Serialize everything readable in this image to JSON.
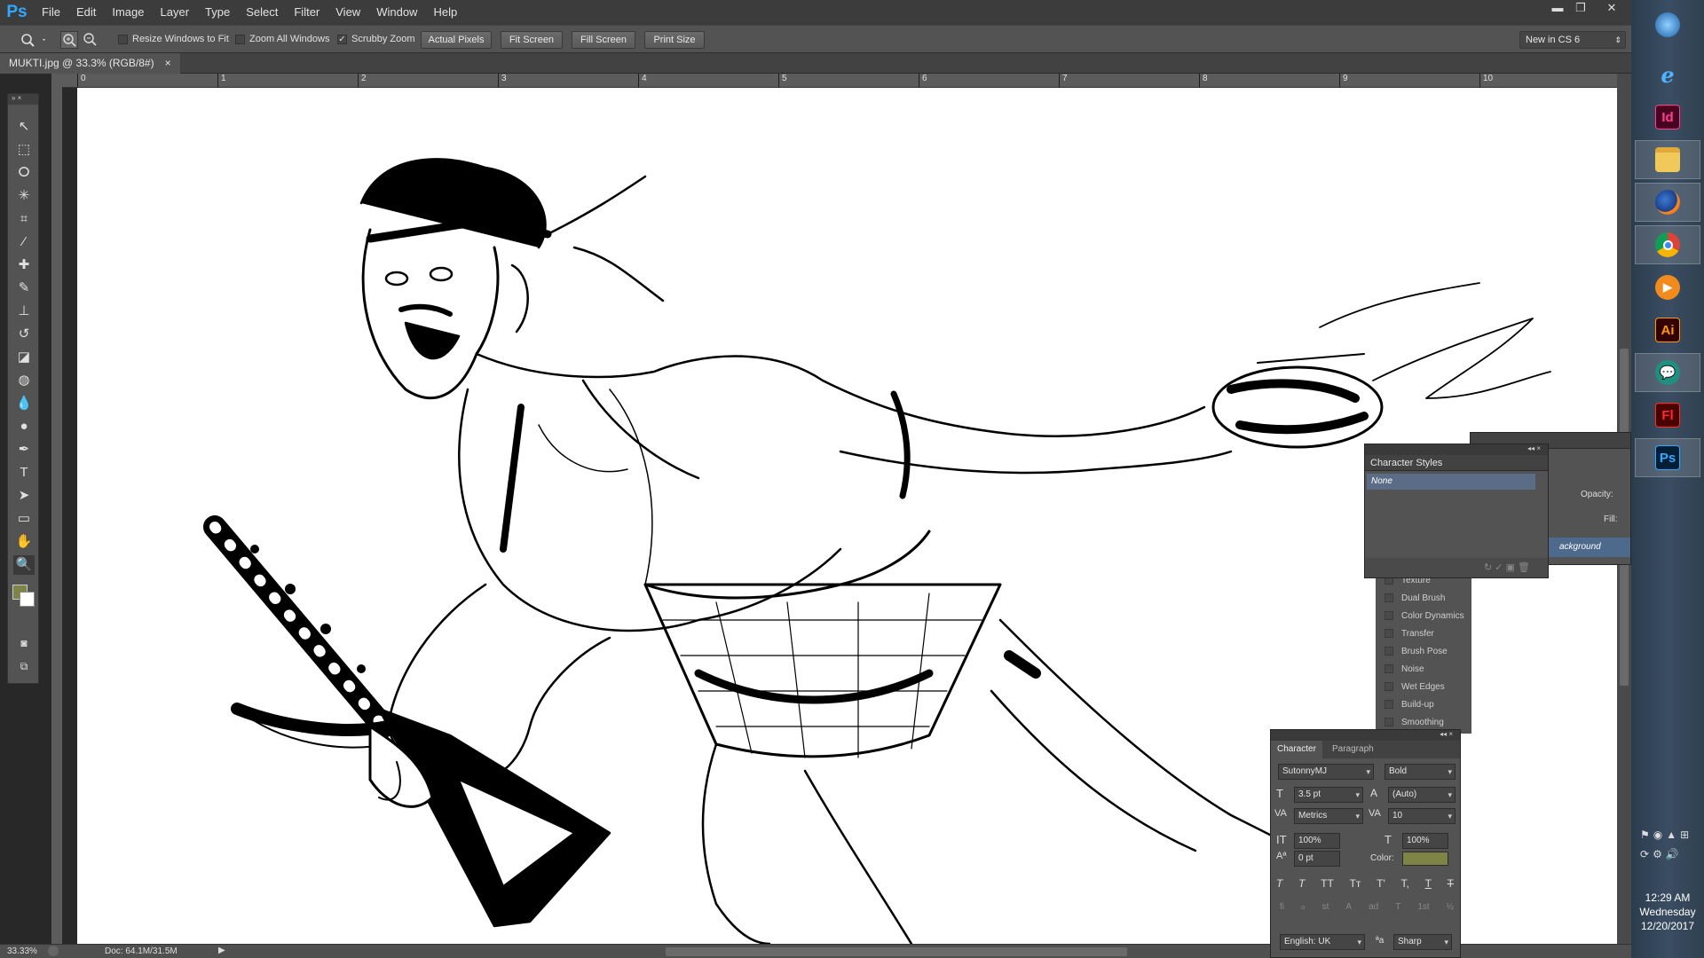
{
  "app": {
    "logo": "Ps"
  },
  "menu": [
    "File",
    "Edit",
    "Image",
    "Layer",
    "Type",
    "Select",
    "Filter",
    "View",
    "Window",
    "Help"
  ],
  "window_controls": {
    "minimize": "▬",
    "restore": "❐",
    "close": "✕"
  },
  "options_bar": {
    "tool_icon": "zoom-icon",
    "resize_windows": "Resize Windows to Fit",
    "zoom_all": "Zoom All Windows",
    "scrubby_zoom": "Scrubby Zoom",
    "scrubby_checked": "✓",
    "actual_pixels": "Actual Pixels",
    "fit_screen": "Fit Screen",
    "fill_screen": "Fill Screen",
    "print_size": "Print Size",
    "workspace": "New in CS 6"
  },
  "document": {
    "tab_title": "MUKTI.jpg @ 33.3% (RGB/8#)",
    "tab_close": "×"
  },
  "ruler": {
    "ticks": [
      "0",
      "1",
      "2",
      "3",
      "4",
      "5",
      "6",
      "7",
      "8",
      "9",
      "10"
    ]
  },
  "status": {
    "zoom": "33.33%",
    "doc": "Doc: 64.1M/31.5M"
  },
  "character_styles": {
    "title": "Character Styles",
    "selected": "None"
  },
  "layers": {
    "opacity_label": "Opacity:",
    "fill_label": "Fill:",
    "background_layer": "ackground"
  },
  "brush_options": [
    "Texture",
    "Dual Brush",
    "Color Dynamics",
    "Transfer",
    "Brush Pose",
    "Noise",
    "Wet Edges",
    "Build-up",
    "Smoothing"
  ],
  "character": {
    "tab_character": "Character",
    "tab_paragraph": "Paragraph",
    "font_family": "SutonnyMJ",
    "font_style": "Bold",
    "font_size": "3.5 pt",
    "leading": "(Auto)",
    "kerning": "Metrics",
    "tracking": "10",
    "vertical_scale": "100%",
    "horizontal_scale": "100%",
    "baseline_shift": "0 pt",
    "color_label": "Color:",
    "color_value": "#7d8446",
    "type_buttons": [
      "T",
      "T",
      "TT",
      "Tт",
      "T'",
      "T,",
      "T",
      "T"
    ],
    "opentype_buttons": [
      "fi",
      "ℴ",
      "st",
      "A",
      "ad",
      "T",
      "1st",
      "½"
    ],
    "language": "English: UK",
    "aa_icon": "ªa",
    "antialias": "Sharp"
  },
  "taskbar": {
    "icons": [
      "windows-start-icon",
      "internet-explorer-icon",
      "indesign-icon",
      "file-explorer-icon",
      "firefox-icon",
      "chrome-icon",
      "media-player-icon",
      "illustrator-icon",
      "messenger-icon",
      "flash-icon",
      "photoshop-icon"
    ],
    "labels": {
      "indesign": "Id",
      "illustrator": "Ai",
      "flash": "Fl",
      "photoshop": "Ps"
    },
    "time": "12:29 AM",
    "day": "Wednesday",
    "date": "12/20/2017"
  }
}
